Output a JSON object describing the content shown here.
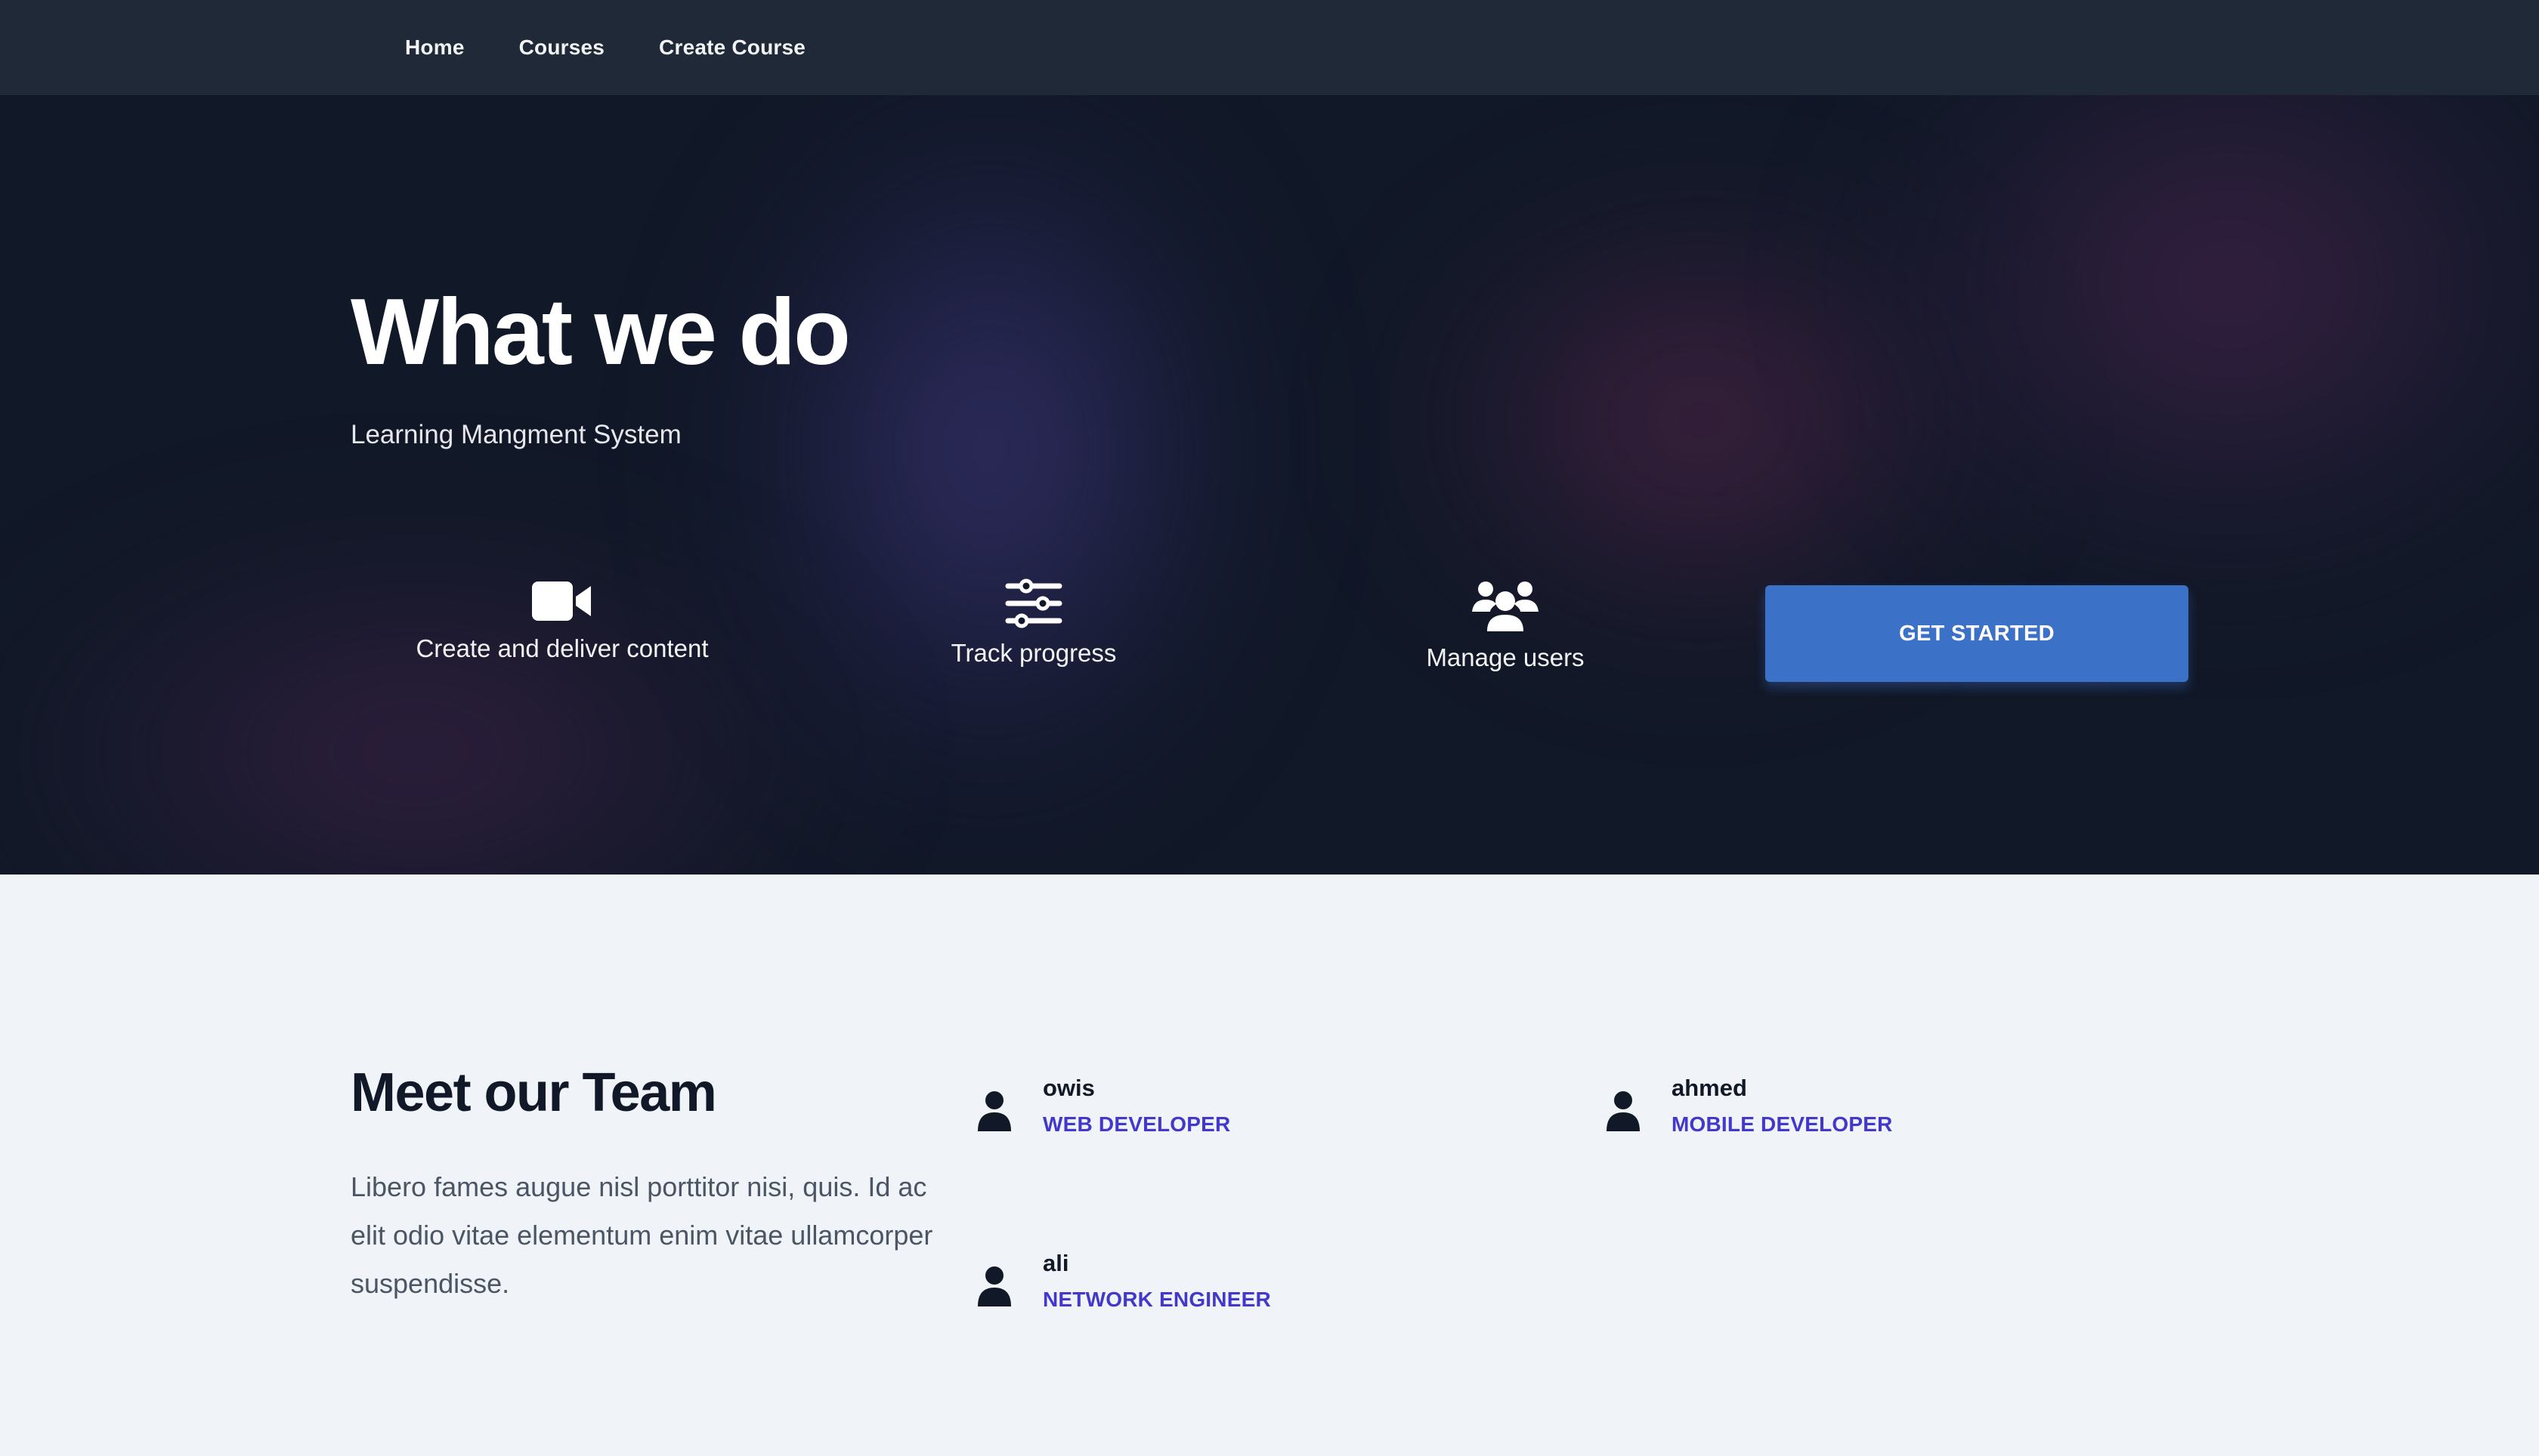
{
  "nav": {
    "items": [
      {
        "label": "Home"
      },
      {
        "label": "Courses"
      },
      {
        "label": "Create Course"
      }
    ]
  },
  "hero": {
    "title": "What we do",
    "subtitle": "Learning Mangment System",
    "features": [
      {
        "icon": "video-camera-icon",
        "label": "Create and deliver content"
      },
      {
        "icon": "sliders-icon",
        "label": "Track progress"
      },
      {
        "icon": "users-icon",
        "label": "Manage users"
      }
    ],
    "cta_label": "GET STARTED"
  },
  "team": {
    "title": "Meet our Team",
    "description": "Libero fames augue nisl porttitor nisi, quis. Id ac elit odio vitae elementum enim vitae ullamcorper suspendisse.",
    "members": [
      {
        "icon": "user-icon",
        "name": "owis",
        "role": "Web Developer"
      },
      {
        "icon": "user-icon",
        "name": "ahmed",
        "role": "Mobile Developer"
      },
      {
        "icon": "user-icon",
        "name": "ali",
        "role": "Network Engineer"
      }
    ]
  },
  "colors": {
    "nav_bg": "#1f2937",
    "hero_bg": "#111827",
    "accent_button": "#3b72c8",
    "role_text": "#4338ca",
    "page_bg": "#f0f4f8"
  }
}
